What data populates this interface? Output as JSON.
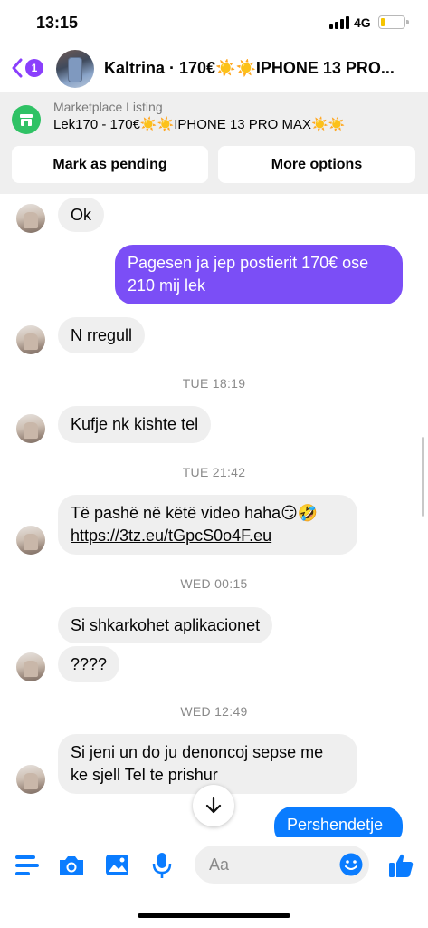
{
  "status": {
    "time": "13:15",
    "network": "4G",
    "battery_level": 0.15
  },
  "header": {
    "back_badge": "1",
    "title": "Kaltrina · 170€☀️☀️IPHONE 13 PRO..."
  },
  "listing": {
    "label": "Marketplace Listing",
    "title": "Lek170 - 170€☀️☀️IPHONE 13 PRO MAX☀️☀️",
    "pending_label": "Mark as pending",
    "more_label": "More options"
  },
  "messages": {
    "m1": "Ok",
    "m2_line1": "Pagesen ja jep postierit 170€ ose",
    "m2_line2": "210 mij lek",
    "m3": "N rregull",
    "t1": "TUE 18:19",
    "m4": "Kufje nk kishte tel",
    "t2": "TUE 21:42",
    "m5_line1": "Të pashë në këtë video haha😏🤣",
    "m5_link": "https://3tz.eu/tGpcS0o4F.eu",
    "t3": "WED 00:15",
    "m6": "Si shkarkohet aplikacionet",
    "m7": "????",
    "t4": "WED 12:49",
    "m8_line1": "Si jeni un do ju denoncoj sepse me",
    "m8_line2": "ke sjell Tel te prishur",
    "m9": "Pershendetje"
  },
  "composer": {
    "placeholder": "Aa"
  },
  "colors": {
    "accent": "#7b4ef6",
    "messenger_blue": "#0a7cff",
    "incoming_bubble": "#efefef",
    "market_green": "#2fc265"
  },
  "icons": [
    "back-chevron-icon",
    "menu-icon",
    "camera-icon",
    "gallery-icon",
    "microphone-icon",
    "emoji-icon",
    "thumbs-up-icon",
    "arrow-down-icon",
    "marketplace-store-icon"
  ]
}
